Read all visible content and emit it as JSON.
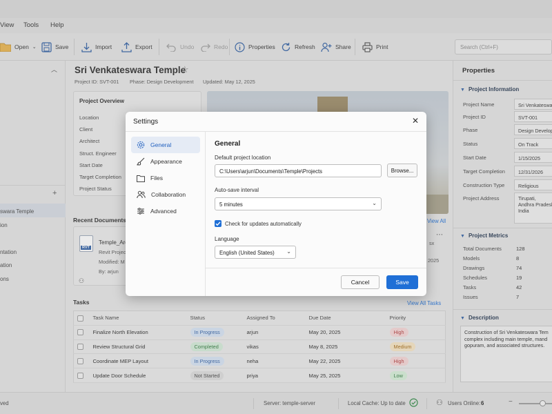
{
  "menu": {
    "items": [
      "View",
      "Tools",
      "Help"
    ]
  },
  "toolbar": {
    "open": "Open",
    "save": "Save",
    "import": "Import",
    "export": "Export",
    "undo": "Undo",
    "redo": "Redo",
    "properties": "Properties",
    "refresh": "Refresh",
    "share": "Share",
    "print": "Print"
  },
  "search": {
    "placeholder": "Search (Ctrl+F)"
  },
  "left_panel": {
    "items": [
      "swara Temple",
      "ion",
      "ntation",
      "ation",
      "ons"
    ]
  },
  "project": {
    "title": "Sri Venkateswara Temple",
    "id": "Project ID: SVT-001",
    "phase": "Phase: Design Development",
    "updated": "Updated: May 12, 2025"
  },
  "overview": {
    "heading": "Project Overview",
    "labels": [
      "Location",
      "Client",
      "Architect",
      "Struct. Engineer",
      "Start Date",
      "Target Completion",
      "Project Status"
    ]
  },
  "recent_docs": {
    "heading": "Recent Documents",
    "view_all": "View All",
    "doc": {
      "name": "Temple_Arc",
      "type_label": "RVT",
      "type": "Revit Project",
      "modified": "Modified: M",
      "by": "By: arjun",
      "side_ext": "sx",
      "side_year": "2025"
    }
  },
  "tasks": {
    "heading": "Tasks",
    "view_all": "View All Tasks",
    "columns": [
      "Task Name",
      "Status",
      "Assigned To",
      "Due Date",
      "Priority"
    ],
    "rows": [
      {
        "name": "Finalize North Elevation",
        "status": "In Progress",
        "assigned": "arjun",
        "due": "May 20, 2025",
        "priority": "High"
      },
      {
        "name": "Review Structural Grid",
        "status": "Completed",
        "assigned": "vikas",
        "due": "May 8, 2025",
        "priority": "Medium"
      },
      {
        "name": "Coordinate MEP Layout",
        "status": "In Progress",
        "assigned": "neha",
        "due": "May 22, 2025",
        "priority": "High"
      },
      {
        "name": "Update Door Schedule",
        "status": "Not Started",
        "assigned": "priya",
        "due": "May 25, 2025",
        "priority": "Low"
      }
    ]
  },
  "properties": {
    "heading": "Properties",
    "info_heading": "Project Information",
    "fields": [
      {
        "label": "Project Name",
        "value": "Sri Venkateswara"
      },
      {
        "label": "Project ID",
        "value": "SVT-001"
      },
      {
        "label": "Phase",
        "value": "Design Develop"
      },
      {
        "label": "Status",
        "value": "On Track"
      },
      {
        "label": "Start Date",
        "value": "1/15/2025"
      },
      {
        "label": "Target Completion",
        "value": "12/31/2026"
      },
      {
        "label": "Construction Type",
        "value": "Religious"
      }
    ],
    "address_label": "Project Address",
    "address_lines": [
      "Tirupati,",
      "Andhra Pradesh,",
      "India"
    ],
    "metrics_heading": "Project Metrics",
    "metrics": [
      {
        "label": "Total Documents",
        "value": "128"
      },
      {
        "label": "Models",
        "value": "8"
      },
      {
        "label": "Drawings",
        "value": "74"
      },
      {
        "label": "Schedules",
        "value": "19"
      },
      {
        "label": "Tasks",
        "value": "42"
      },
      {
        "label": "Issues",
        "value": "7"
      }
    ],
    "description_heading": "Description",
    "description_lines": [
      "Construction of Sri Venkateswara Tem",
      "complex including main temple, mand",
      "gopuram, and associated structures."
    ]
  },
  "statusbar": {
    "left": "ved",
    "server": "Server: temple-server",
    "cache": "Local Cache: Up to date",
    "users_label": "Users Online:",
    "users_count": "6"
  },
  "dialog": {
    "title": "Settings",
    "nav": [
      "General",
      "Appearance",
      "Files",
      "Collaboration",
      "Advanced"
    ],
    "section_title": "General",
    "location_label": "Default project location",
    "location_value": "C:\\Users\\arjun\\Documents\\Temple\\Projects",
    "browse": "Browse...",
    "autosave_label": "Auto-save interval",
    "autosave_value": "5 minutes",
    "updates_label": "Check for updates automatically",
    "updates_checked": true,
    "language_label": "Language",
    "language_value": "English (United States)",
    "cancel": "Cancel",
    "save": "Save"
  },
  "colors": {
    "accent": "#1f6fd6",
    "in_progress": "#d6e3f5",
    "completed": "#d4ecd8",
    "not_started": "#dcdcdc",
    "high": "#f6d6d6",
    "medium": "#f7e4c2",
    "low": "#d6efd8"
  }
}
